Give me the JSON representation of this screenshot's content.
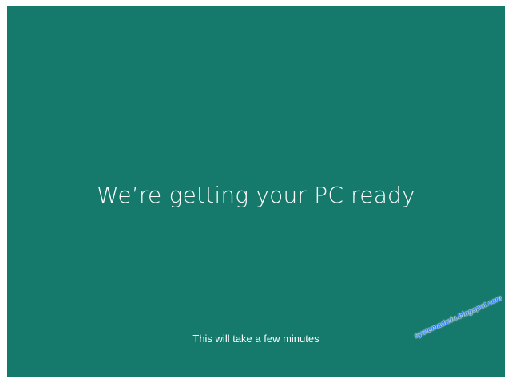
{
  "screen": {
    "headline": "We’re getting your PC ready",
    "subtext": "This will take a few minutes",
    "watermark": "systemadmin.blogspot.com",
    "background_color": "#15796b",
    "text_color": "#ffffff"
  }
}
